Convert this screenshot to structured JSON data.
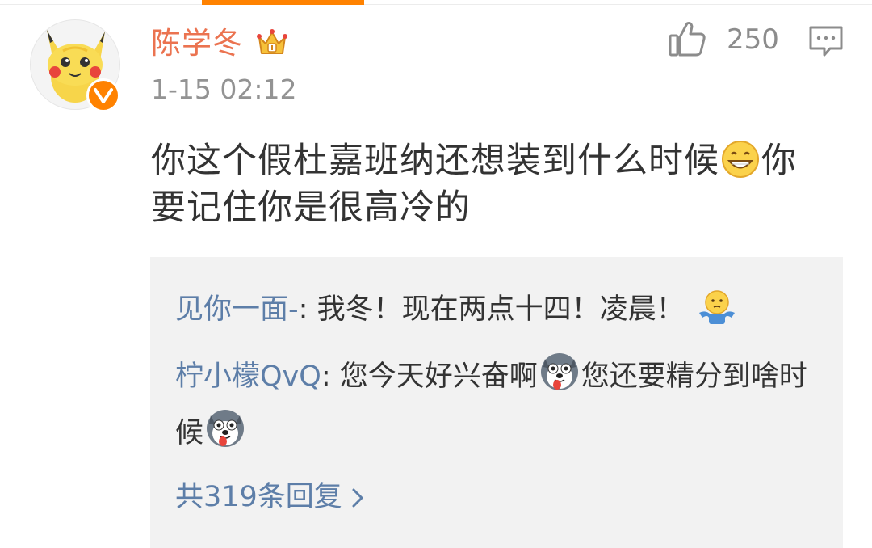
{
  "user": {
    "name": "陈学冬",
    "timestamp": "1-15 02:12"
  },
  "actions": {
    "like_count": "250",
    "like_icon": "thumbs-up-icon",
    "comment_icon": "comment-icon"
  },
  "comment": {
    "part1": "你这个假杜嘉班纳还想装到什么时候",
    "emoji1": "grin-emoji",
    "part2": "你要记住你是很高冷的"
  },
  "replies": [
    {
      "author": "见你一面-",
      "colon": ": ",
      "text": "我冬！现在两点十四！凌晨！",
      "emoji": "shrug-emoji"
    },
    {
      "author": "柠小檬QvQ",
      "colon": ": ",
      "text": "您今天好兴奋啊",
      "emoji": "husky-emoji",
      "text2": "您还要精分到啥时候",
      "emoji2": "husky-emoji"
    }
  ],
  "more_replies": {
    "label": "共319条回复"
  },
  "colors": {
    "accent_orange": "#ff8200",
    "username": "#eb7350",
    "link_blue": "#5d7ea8",
    "reply_bg": "#f2f2f2",
    "meta_gray": "#939393"
  }
}
